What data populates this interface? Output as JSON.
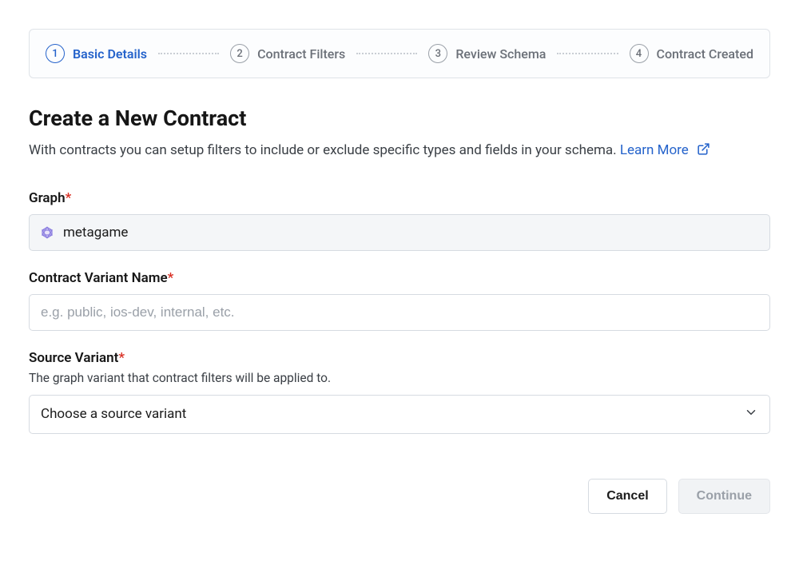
{
  "stepper": {
    "steps": [
      {
        "num": "1",
        "label": "Basic Details"
      },
      {
        "num": "2",
        "label": "Contract Filters"
      },
      {
        "num": "3",
        "label": "Review Schema"
      },
      {
        "num": "4",
        "label": "Contract Created"
      }
    ]
  },
  "header": {
    "title": "Create a New Contract",
    "description": "With contracts you can setup filters to include or exclude specific types and fields in your schema.",
    "learn_more": "Learn More"
  },
  "fields": {
    "graph": {
      "label": "Graph",
      "value": "metagame"
    },
    "variant_name": {
      "label": "Contract Variant Name",
      "placeholder": "e.g. public, ios-dev, internal, etc."
    },
    "source_variant": {
      "label": "Source Variant",
      "helper": "The graph variant that contract filters will be applied to.",
      "placeholder": "Choose a source variant"
    }
  },
  "actions": {
    "cancel": "Cancel",
    "continue": "Continue"
  },
  "required_marker": "*"
}
